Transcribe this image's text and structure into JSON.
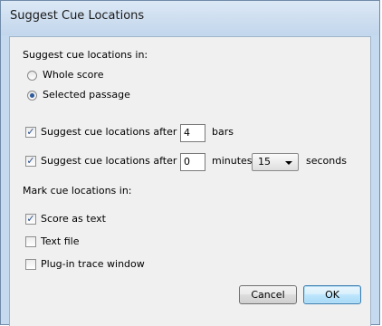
{
  "window": {
    "title": "Suggest Cue Locations"
  },
  "section_suggest": {
    "heading": "Suggest cue locations in:",
    "options": [
      {
        "label": "Whole score",
        "selected": false
      },
      {
        "label": "Selected passage",
        "selected": true
      }
    ]
  },
  "bars_row": {
    "label": "Suggest cue locations after",
    "checked": true,
    "value": "4",
    "unit": "bars"
  },
  "time_row": {
    "label": "Suggest cue locations after",
    "checked": true,
    "minutes_value": "0",
    "minutes_unit": "minutes",
    "seconds_value": "15",
    "seconds_unit": "seconds"
  },
  "section_mark": {
    "heading": "Mark cue locations in:",
    "options": [
      {
        "label": "Score as text",
        "checked": true
      },
      {
        "label": "Text file",
        "checked": false
      },
      {
        "label": "Plug-in trace window",
        "checked": false
      }
    ]
  },
  "buttons": {
    "cancel": "Cancel",
    "ok": "OK"
  },
  "colors": {
    "frame": "#c5d9ef",
    "client": "#f0f0f0",
    "check_mark": "#2a4f8a",
    "radio_dot": "#2e5b9c",
    "default_button_border": "#3c7fb1"
  }
}
